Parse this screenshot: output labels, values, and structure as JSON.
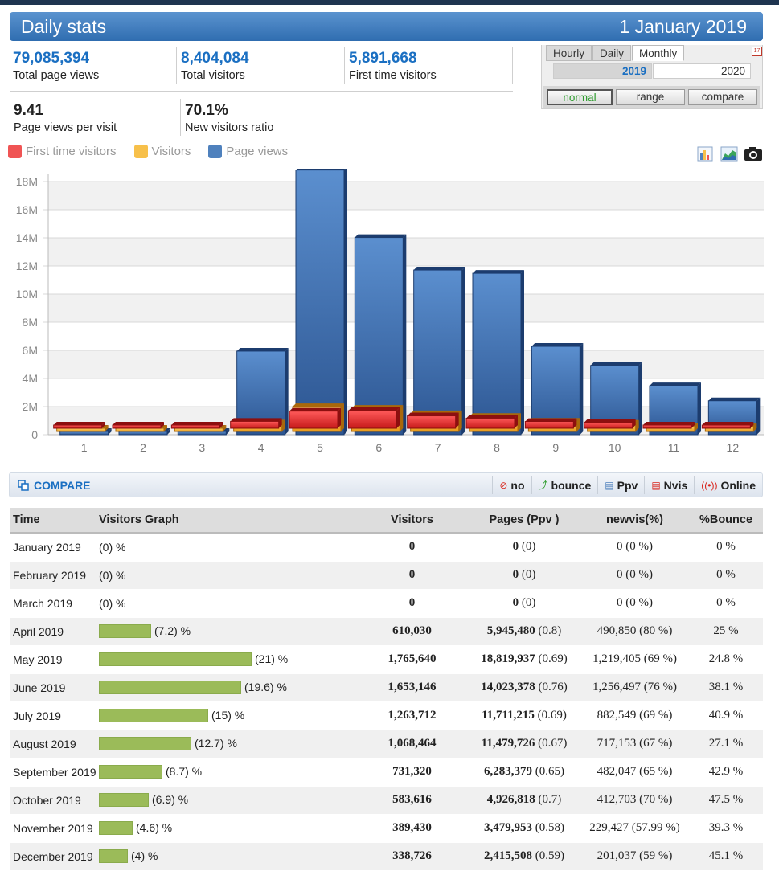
{
  "header": {
    "title": "Daily stats",
    "date": "1 January 2019"
  },
  "summary": {
    "total_page_views": {
      "value": "79,085,394",
      "label": "Total page views"
    },
    "total_visitors": {
      "value": "8,404,084",
      "label": "Total visitors"
    },
    "first_time_visitors": {
      "value": "5,891,668",
      "label": "First time visitors"
    },
    "page_views_per_visit": {
      "value": "9.41",
      "label": "Page views per visit"
    },
    "new_visitors_ratio": {
      "value": "70.1%",
      "label": "New visitors ratio"
    }
  },
  "period_panel": {
    "tabs": [
      "Hourly",
      "Daily",
      "Monthly"
    ],
    "active_tab": "Monthly",
    "selected_year": "2019",
    "other_year": "2020",
    "modes": [
      "normal",
      "range",
      "compare"
    ],
    "active_mode": "normal",
    "calendar_icon": "calendar-icon"
  },
  "legend": [
    {
      "label": "First time visitors",
      "color": "#f05454"
    },
    {
      "label": "Visitors",
      "color": "#f7c04a"
    },
    {
      "label": "Page views",
      "color": "#4f81bd"
    }
  ],
  "chart_tools": [
    "bar-chart-icon",
    "area-chart-icon",
    "camera-icon"
  ],
  "chart_data": {
    "type": "bar",
    "categories": [
      "1",
      "2",
      "3",
      "4",
      "5",
      "6",
      "7",
      "8",
      "9",
      "10",
      "11",
      "12"
    ],
    "series": [
      {
        "name": "First time visitors",
        "values": [
          0,
          0,
          0,
          490850,
          1219405,
          1256497,
          882549,
          717153,
          482047,
          412703,
          229427,
          201037
        ]
      },
      {
        "name": "Visitors",
        "values": [
          0,
          0,
          0,
          610030,
          1765640,
          1653146,
          1263712,
          1068464,
          731320,
          583616,
          389430,
          338726
        ]
      },
      {
        "name": "Page views",
        "values": [
          0,
          0,
          0,
          5945480,
          18819937,
          14023378,
          11711215,
          11479726,
          6283379,
          4926818,
          3479953,
          2415508
        ]
      }
    ],
    "y_ticks": [
      "0",
      "2M",
      "4M",
      "6M",
      "8M",
      "10M",
      "12M",
      "14M",
      "16M",
      "18M"
    ],
    "ylim": [
      0,
      18000000
    ],
    "grid": true,
    "legend_position": "top-left"
  },
  "compare_bar": {
    "compare_label": "COMPARE",
    "options": [
      {
        "label": "no",
        "icon": "no-icon"
      },
      {
        "label": "bounce",
        "icon": "bounce-icon"
      },
      {
        "label": "Ppv",
        "icon": "ppv-icon"
      },
      {
        "label": "Nvis",
        "icon": "nvis-icon"
      },
      {
        "label": "Online",
        "icon": "online-icon"
      }
    ]
  },
  "table": {
    "columns": [
      "Time",
      "Visitors Graph",
      "Visitors",
      "Pages (Ppv )",
      "newvis(%)",
      "%Bounce"
    ],
    "rows": [
      {
        "time": "January 2019",
        "graph_pct": 0,
        "graph_label": "(0) %",
        "visitors": "0",
        "pages": "0",
        "ppv": "(0)",
        "newvis": "0 (0 %)",
        "bounce": "0 %"
      },
      {
        "time": "February 2019",
        "graph_pct": 0,
        "graph_label": "(0) %",
        "visitors": "0",
        "pages": "0",
        "ppv": "(0)",
        "newvis": "0 (0 %)",
        "bounce": "0 %"
      },
      {
        "time": "March 2019",
        "graph_pct": 0,
        "graph_label": "(0) %",
        "visitors": "0",
        "pages": "0",
        "ppv": "(0)",
        "newvis": "0 (0 %)",
        "bounce": "0 %"
      },
      {
        "time": "April 2019",
        "graph_pct": 7.2,
        "graph_label": "(7.2) %",
        "visitors": "610,030",
        "pages": "5,945,480",
        "ppv": "(0.8)",
        "newvis": "490,850 (80 %)",
        "bounce": "25 %"
      },
      {
        "time": "May 2019",
        "graph_pct": 21,
        "graph_label": "(21) %",
        "visitors": "1,765,640",
        "pages": "18,819,937",
        "ppv": "(0.69)",
        "newvis": "1,219,405 (69 %)",
        "bounce": "24.8 %"
      },
      {
        "time": "June 2019",
        "graph_pct": 19.6,
        "graph_label": "(19.6) %",
        "visitors": "1,653,146",
        "pages": "14,023,378",
        "ppv": "(0.76)",
        "newvis": "1,256,497 (76 %)",
        "bounce": "38.1 %"
      },
      {
        "time": "July 2019",
        "graph_pct": 15,
        "graph_label": "(15) %",
        "visitors": "1,263,712",
        "pages": "11,711,215",
        "ppv": "(0.69)",
        "newvis": "882,549 (69 %)",
        "bounce": "40.9 %"
      },
      {
        "time": "August 2019",
        "graph_pct": 12.7,
        "graph_label": "(12.7) %",
        "visitors": "1,068,464",
        "pages": "11,479,726",
        "ppv": "(0.67)",
        "newvis": "717,153 (67 %)",
        "bounce": "27.1 %"
      },
      {
        "time": "September 2019",
        "graph_pct": 8.7,
        "graph_label": "(8.7) %",
        "visitors": "731,320",
        "pages": "6,283,379",
        "ppv": "(0.65)",
        "newvis": "482,047 (65 %)",
        "bounce": "42.9 %"
      },
      {
        "time": "October 2019",
        "graph_pct": 6.9,
        "graph_label": "(6.9) %",
        "visitors": "583,616",
        "pages": "4,926,818",
        "ppv": "(0.7)",
        "newvis": "412,703 (70 %)",
        "bounce": "47.5 %"
      },
      {
        "time": "November 2019",
        "graph_pct": 4.6,
        "graph_label": "(4.6) %",
        "visitors": "389,430",
        "pages": "3,479,953",
        "ppv": "(0.58)",
        "newvis": "229,427 (57.99 %)",
        "bounce": "39.3 %"
      },
      {
        "time": "December 2019",
        "graph_pct": 4,
        "graph_label": "(4) %",
        "visitors": "338,726",
        "pages": "2,415,508",
        "ppv": "(0.59)",
        "newvis": "201,037 (59 %)",
        "bounce": "45.1 %"
      }
    ]
  }
}
